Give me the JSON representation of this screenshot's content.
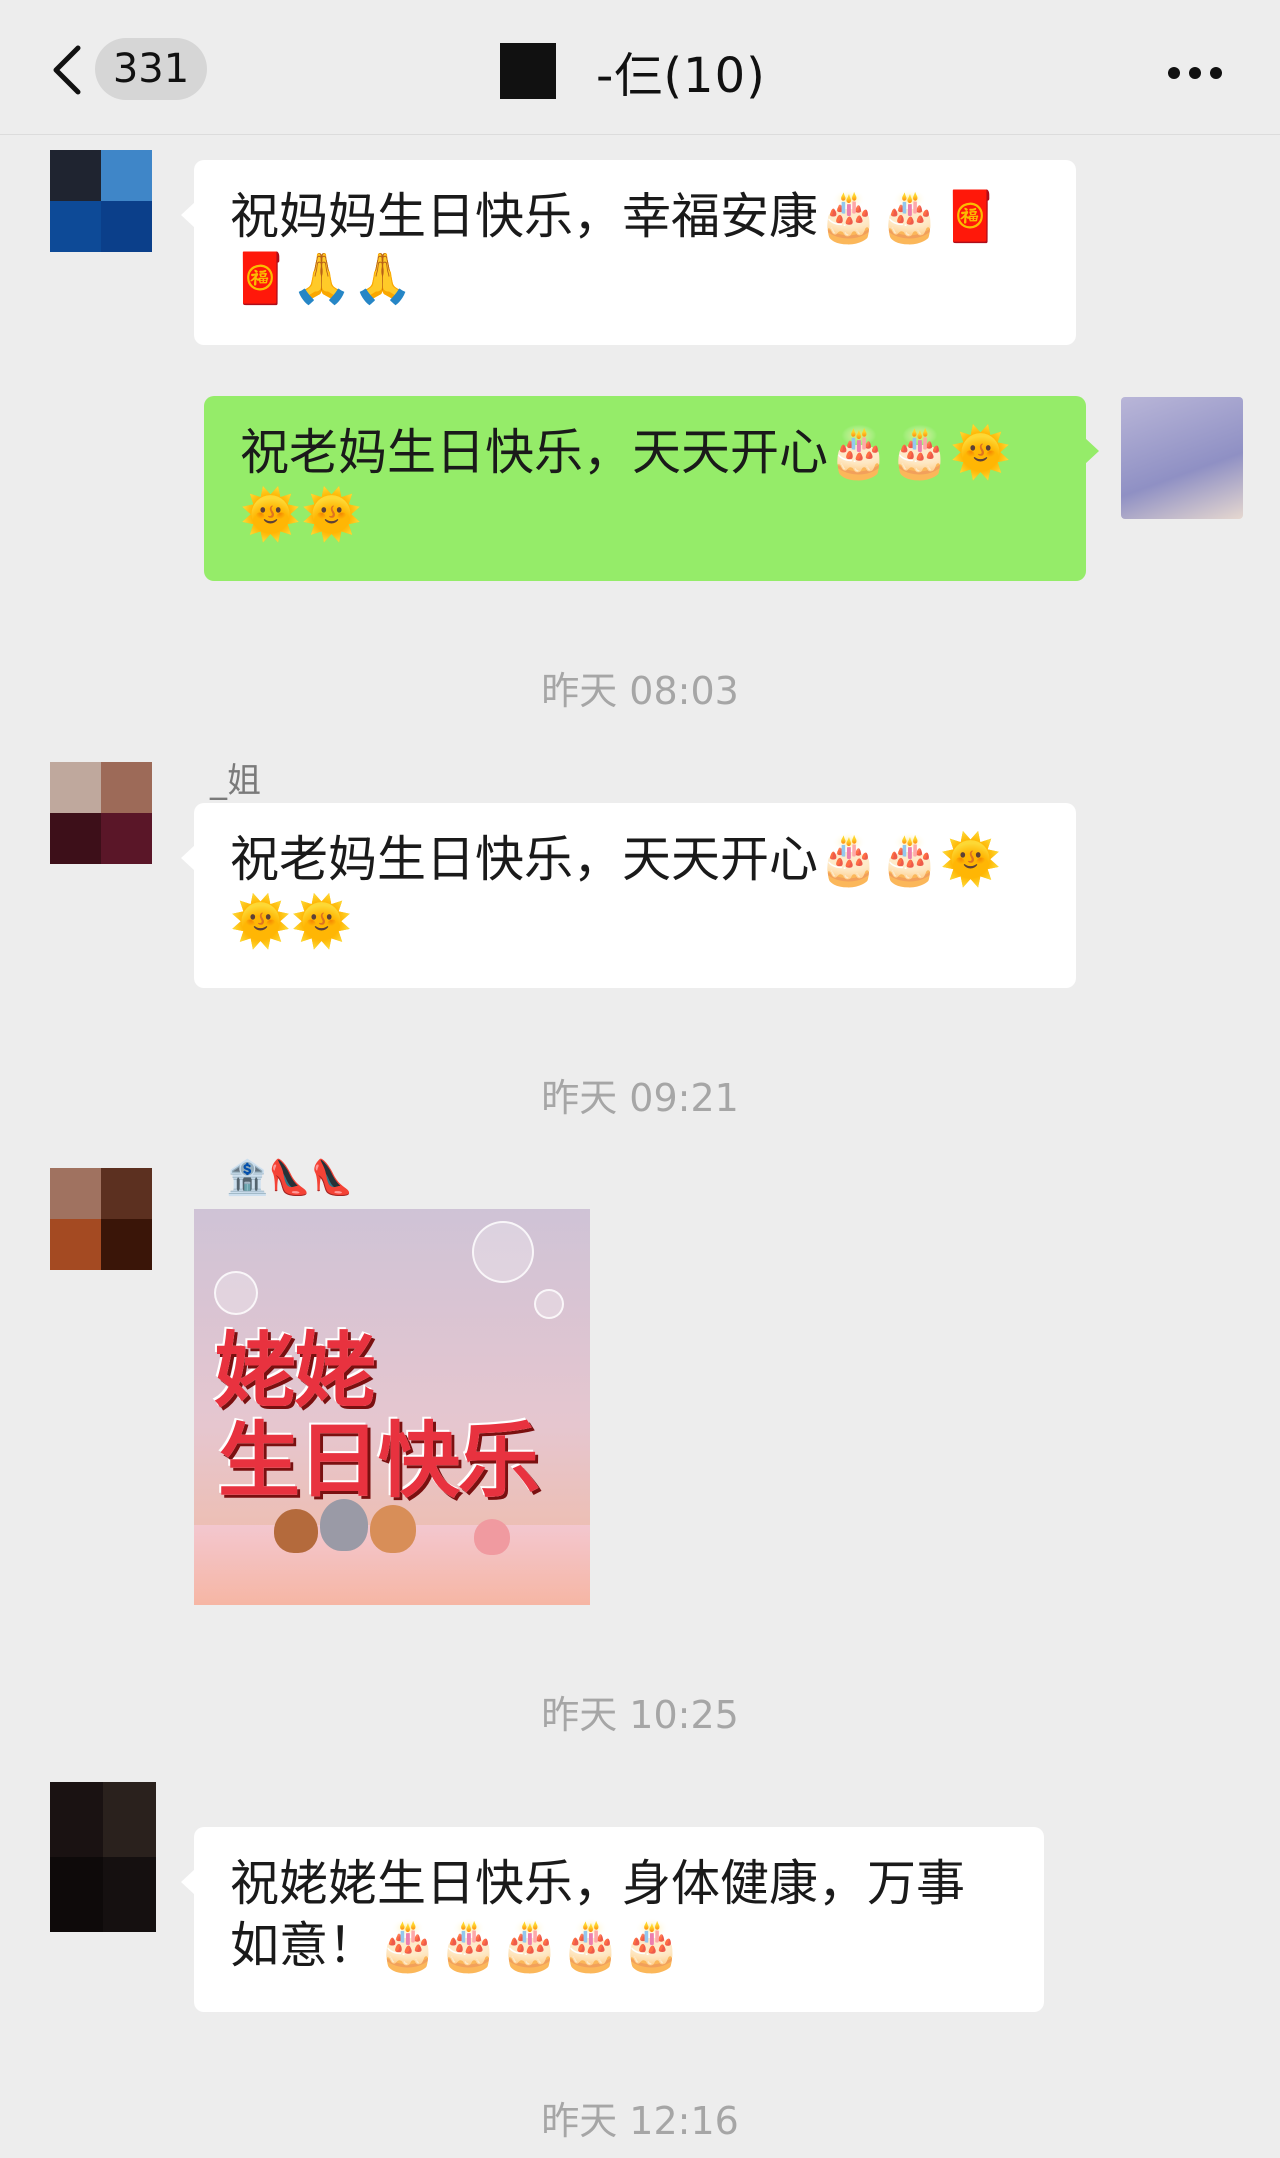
{
  "header": {
    "back_icon": "chevron-left-icon",
    "unread_count": "331",
    "title": "-仨(10)",
    "more_icon": "more-horizontal-icon"
  },
  "messages": [
    {
      "text": "祝妈妈生日快乐，幸福安康🎂🎂🧧🧧🙏🙏"
    },
    {
      "text": "祝老妈生日快乐，天天开心🎂🎂🌞🌞🌞"
    },
    {
      "time": "昨天 08:03",
      "sender": "_姐",
      "text": "祝老妈生日快乐，天天开心🎂🎂🌞🌞🌞"
    },
    {
      "time": "昨天 09:21",
      "sender": "🏦👠👠",
      "sticker_text_line1": "姥姥",
      "sticker_text_line2": "生日快乐"
    },
    {
      "time": "昨天 10:25",
      "text": "祝姥姥生日快乐，身体健康，万事如意！🎂🎂🎂🎂🎂"
    },
    {
      "time": "昨天 12:16"
    }
  ],
  "colors": {
    "background": "#ededed",
    "bubble_in": "#ffffff",
    "bubble_out": "#95ec69",
    "timestamp": "#a6a6a6"
  }
}
